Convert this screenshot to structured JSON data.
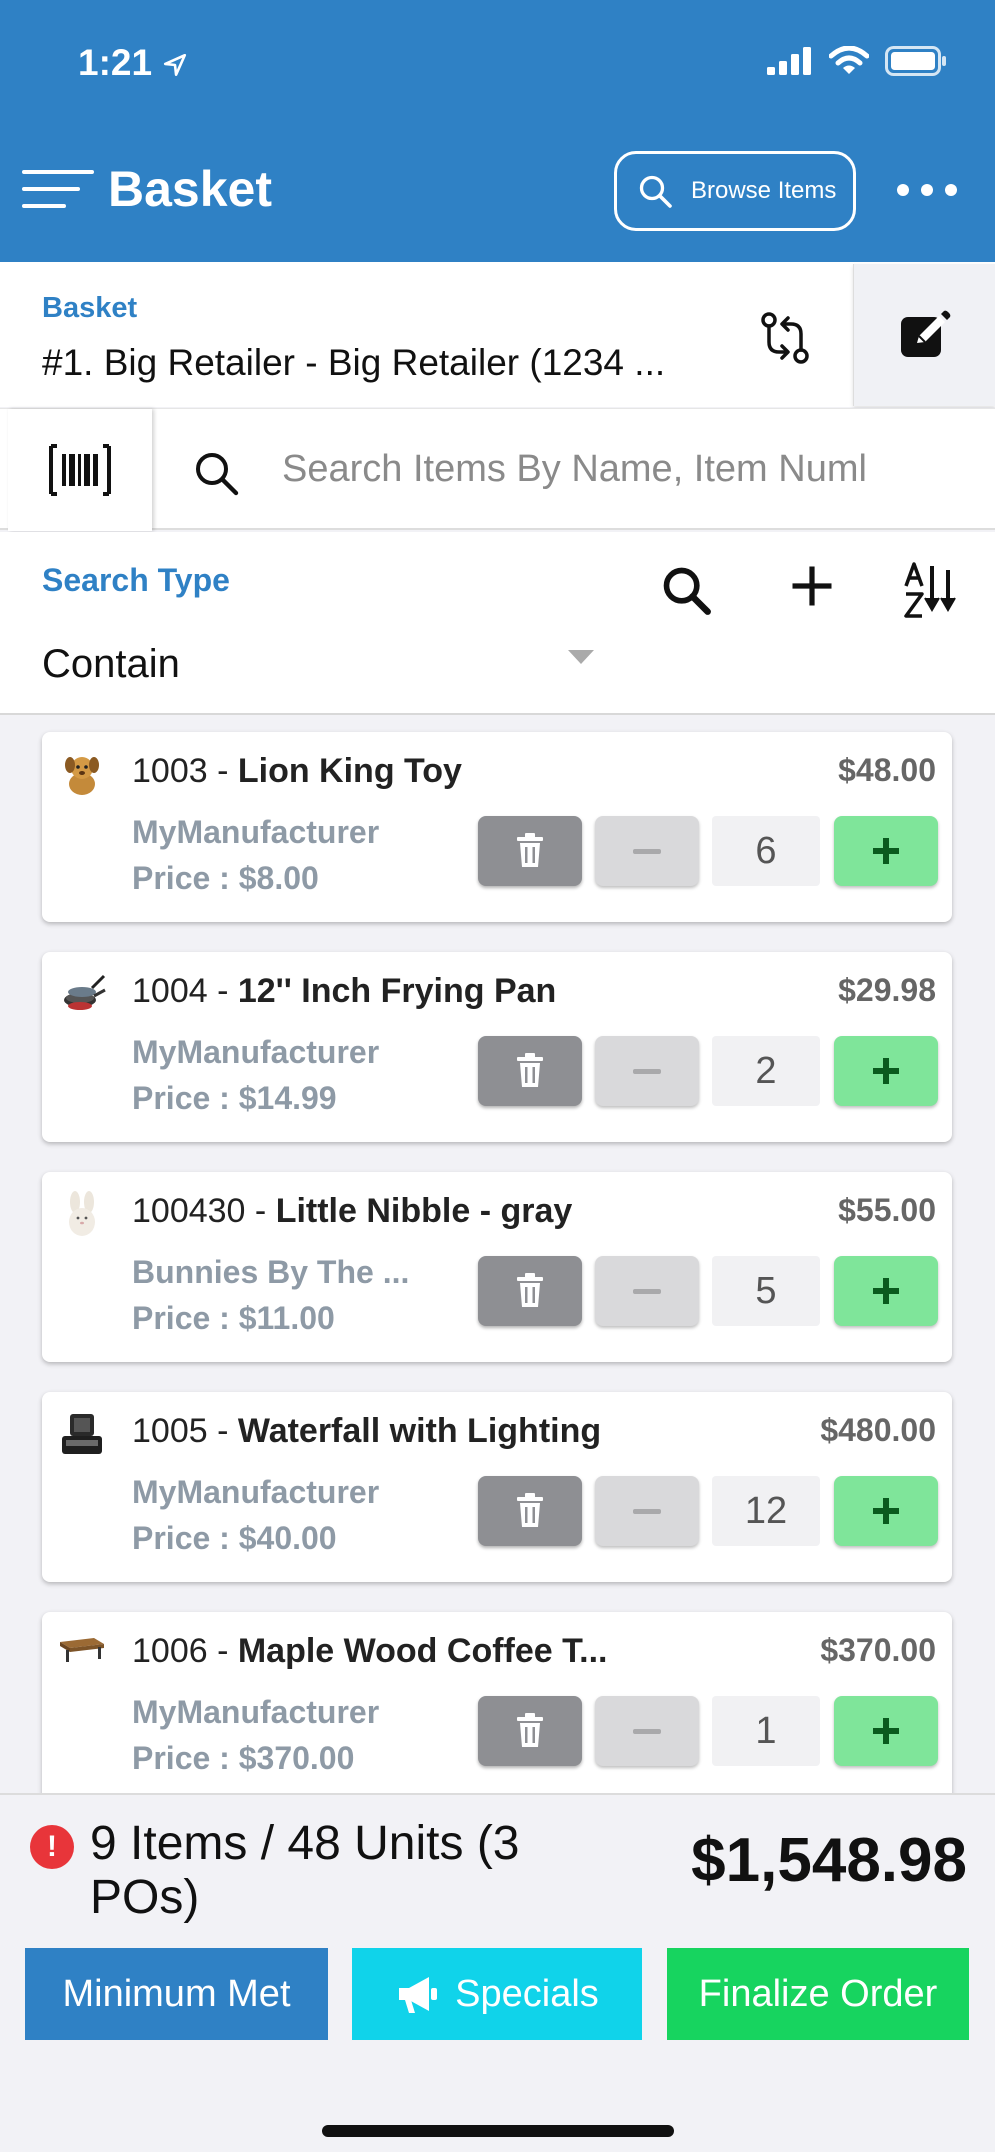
{
  "status_bar": {
    "time": "1:21"
  },
  "header": {
    "title": "Basket",
    "browse_label": "Browse Items"
  },
  "basket": {
    "label": "Basket",
    "name": "#1. Big Retailer - Big Retailer (1234 ..."
  },
  "search": {
    "placeholder": "Search Items By Name, Item Numl"
  },
  "search_type": {
    "label": "Search Type",
    "value": "Contain"
  },
  "items": [
    {
      "number": "1003",
      "name": "Lion King Toy",
      "total": "$48.00",
      "manufacturer": "MyManufacturer",
      "price": "Price : $8.00",
      "qty": "6",
      "thumb": "plush-toy-icon"
    },
    {
      "number": "1004",
      "name": "12'' Inch Frying Pan",
      "total": "$29.98",
      "manufacturer": "MyManufacturer",
      "price": "Price : $14.99",
      "qty": "2",
      "thumb": "frying-pan-icon"
    },
    {
      "number": "100430",
      "name": "Little Nibble - gray",
      "total": "$55.00",
      "manufacturer": "Bunnies By The ...",
      "price": "Price : $11.00",
      "qty": "5",
      "thumb": "bunny-icon"
    },
    {
      "number": "1005",
      "name": "Waterfall with Lighting",
      "total": "$480.00",
      "manufacturer": "MyManufacturer",
      "price": "Price : $40.00",
      "qty": "12",
      "thumb": "fountain-icon"
    },
    {
      "number": "1006",
      "name": "Maple Wood Coffee T...",
      "total": "$370.00",
      "manufacturer": "MyManufacturer",
      "price": "Price : $370.00",
      "qty": "1",
      "thumb": "coffee-table-icon"
    }
  ],
  "footer": {
    "summary": "9 Items / 48 Units (3 POs)",
    "grand_total": "$1,548.98",
    "minimum_label": "Minimum Met",
    "specials_label": "Specials",
    "finalize_label": "Finalize Order"
  },
  "colors": {
    "brand_blue": "#2f81c5",
    "specials_cyan": "#10d3ea",
    "finalize_green": "#17d45f",
    "plus_green": "#7fe59a",
    "alert_red": "#e8353a"
  }
}
